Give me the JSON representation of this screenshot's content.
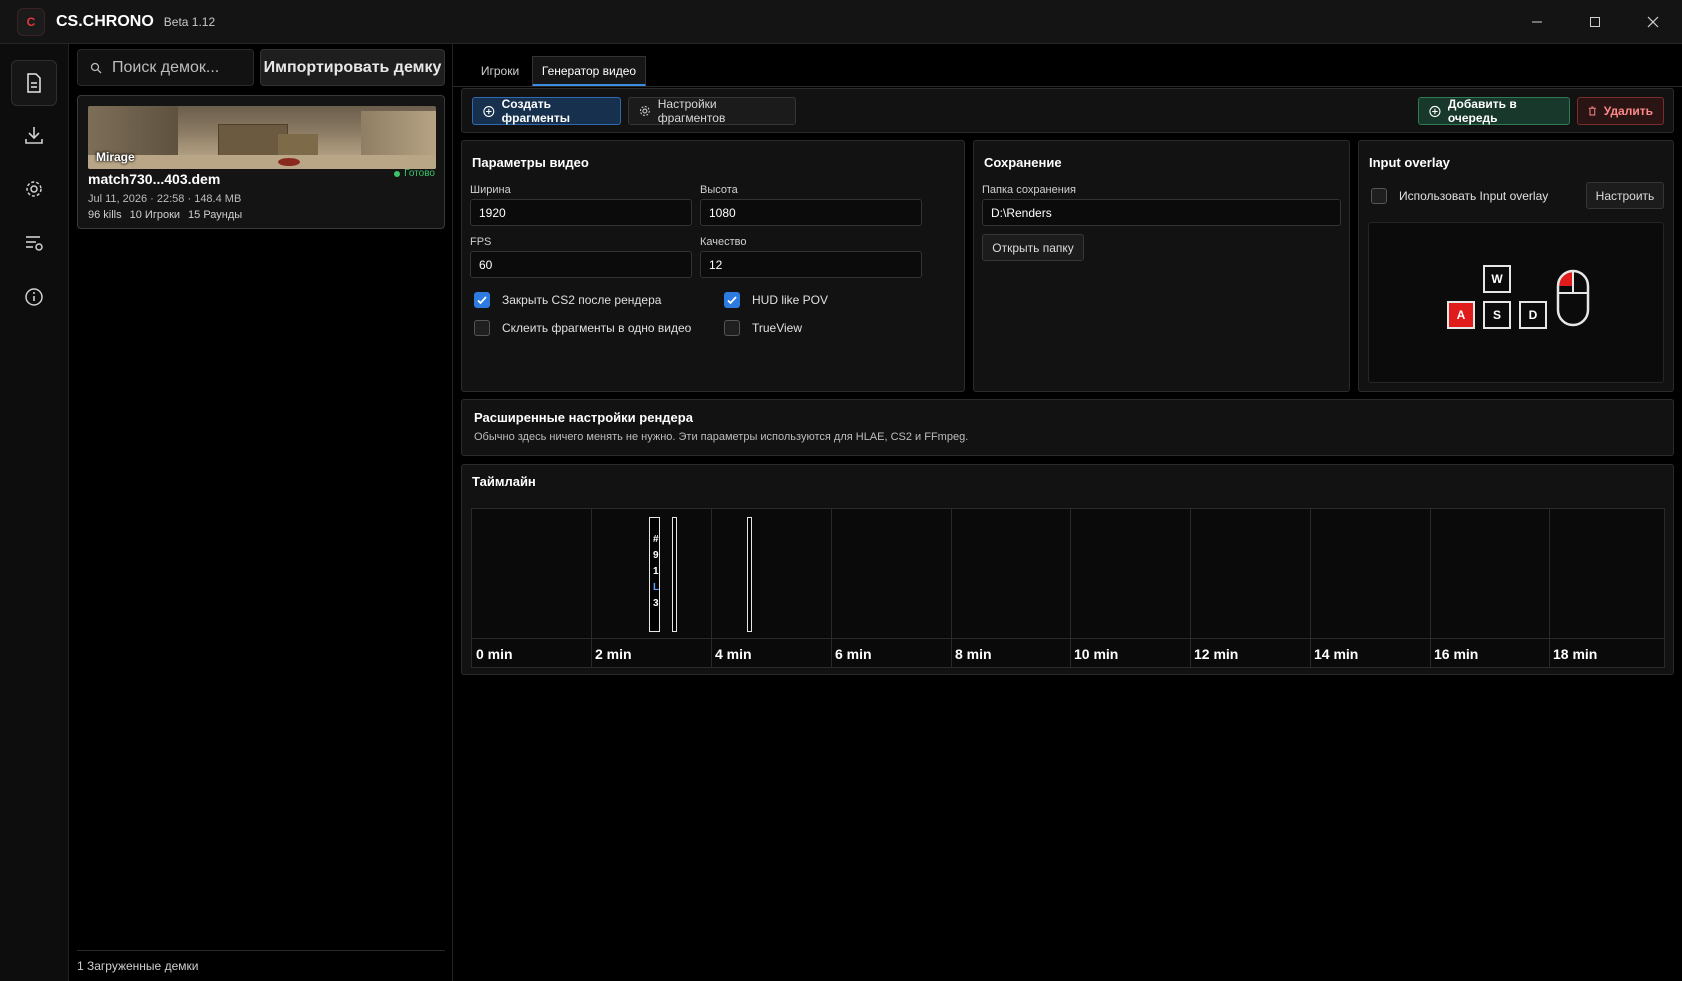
{
  "app": {
    "logo_glyph": "C",
    "title": "CS.CHRONO",
    "version": "Beta 1.12"
  },
  "window_controls": {
    "minimize": "—",
    "maximize": "☐",
    "close": "✕"
  },
  "nav": {
    "items": [
      {
        "name": "demos",
        "icon": "document-icon",
        "active": true
      },
      {
        "name": "download",
        "icon": "download-icon",
        "active": false
      },
      {
        "name": "settings",
        "icon": "gear-icon",
        "active": false
      },
      {
        "name": "queue",
        "icon": "queue-list-icon",
        "active": false
      },
      {
        "name": "info",
        "icon": "info-icon",
        "active": false
      }
    ]
  },
  "demos": {
    "search_placeholder": "Поиск демок...",
    "import_label": "Импортировать демку",
    "card": {
      "map": "Mirage",
      "status": "Готово",
      "name": "match730...403.dem",
      "meta": "Jul 11, 2026  ·  22:58  ·  148.4 MB",
      "stats": [
        "96 kills",
        "10 Игроки",
        "15 Раунды"
      ]
    },
    "footer": "1 Загруженные демки"
  },
  "tabs": [
    {
      "label": "Игроки",
      "active": false
    },
    {
      "label": "Генератор видео",
      "active": true
    }
  ],
  "toolbar": {
    "create_label": "Создать фрагменты",
    "settings_label": "Настройки фрагментов",
    "queue_label": "Добавить в очередь",
    "delete_label": "Удалить"
  },
  "video_params": {
    "title": "Параметры видео",
    "width_label": "Ширина",
    "width_value": "1920",
    "height_label": "Высота",
    "height_value": "1080",
    "fps_label": "FPS",
    "fps_value": "60",
    "quality_label": "Качество",
    "quality_value": "12",
    "close_cs2_label": "Закрыть CS2 после рендера",
    "close_cs2": true,
    "hud_pov_label": "HUD like POV",
    "hud_pov": true,
    "merge_label": "Склеить фрагменты в одно видео",
    "merge": false,
    "trueview_label": "TrueView",
    "trueview": false
  },
  "save": {
    "title": "Сохранение",
    "folder_label": "Папка сохранения",
    "folder_value": "D:\\Renders",
    "open_label": "Открыть папку"
  },
  "overlay": {
    "title": "Input overlay",
    "use_label": "Использовать Input overlay",
    "use": false,
    "configure_label": "Настроить",
    "keys": {
      "w": "W",
      "a": "A",
      "s": "S",
      "d": "D"
    },
    "pressed_key": "A",
    "mouse_pressed": "left"
  },
  "advanced": {
    "title": "Расширенные настройки рендера",
    "description": "Обычно здесь ничего менять не нужно. Эти параметры используются для HLAE, CS2 и FFmpeg."
  },
  "timeline": {
    "title": "Таймлайн",
    "labels": [
      "0 min",
      "2 min",
      "4 min",
      "6 min",
      "8 min",
      "10 min",
      "12 min",
      "14 min",
      "16 min",
      "18 min"
    ],
    "clip_text": [
      "#",
      "9",
      "1",
      "L",
      "3"
    ]
  }
}
